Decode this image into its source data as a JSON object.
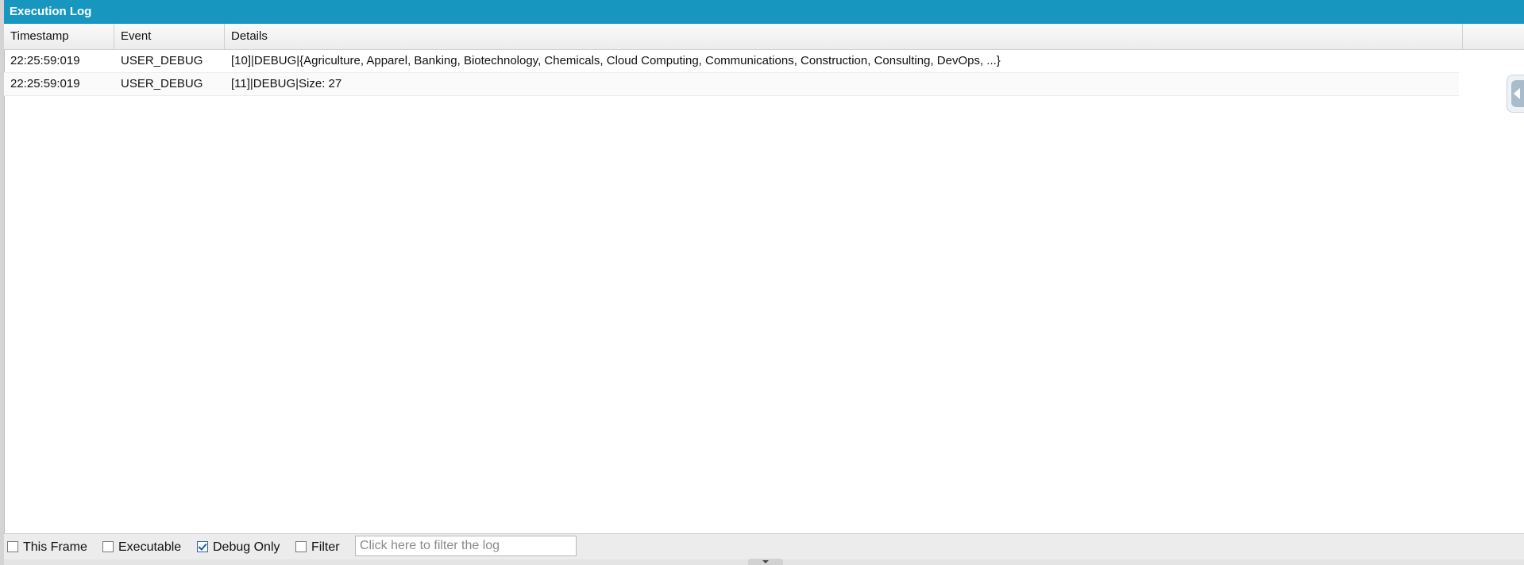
{
  "panel": {
    "title": "Execution Log"
  },
  "grid": {
    "columns": {
      "timestamp": "Timestamp",
      "event": "Event",
      "details": "Details"
    },
    "rows": [
      {
        "timestamp": "22:25:59:019",
        "event": "USER_DEBUG",
        "details": "[10]|DEBUG|{Agriculture, Apparel, Banking, Biotechnology, Chemicals, Cloud Computing, Communications, Construction, Consulting, DevOps, ...}"
      },
      {
        "timestamp": "22:25:59:019",
        "event": "USER_DEBUG",
        "details": "[11]|DEBUG|Size: 27"
      }
    ]
  },
  "footer": {
    "this_frame": {
      "label": "This Frame",
      "checked": false
    },
    "executable": {
      "label": "Executable",
      "checked": false
    },
    "debug_only": {
      "label": "Debug Only",
      "checked": true
    },
    "filter": {
      "label": "Filter",
      "checked": false
    },
    "filter_input": {
      "placeholder": "Click here to filter the log",
      "value": ""
    }
  },
  "icons": {
    "side_tab": "collapse-arrow-left-icon",
    "bottom_handle": "chevron-down-icon"
  },
  "colors": {
    "titlebar": "#1797c0",
    "checkbox_check": "#1e5aa8"
  }
}
